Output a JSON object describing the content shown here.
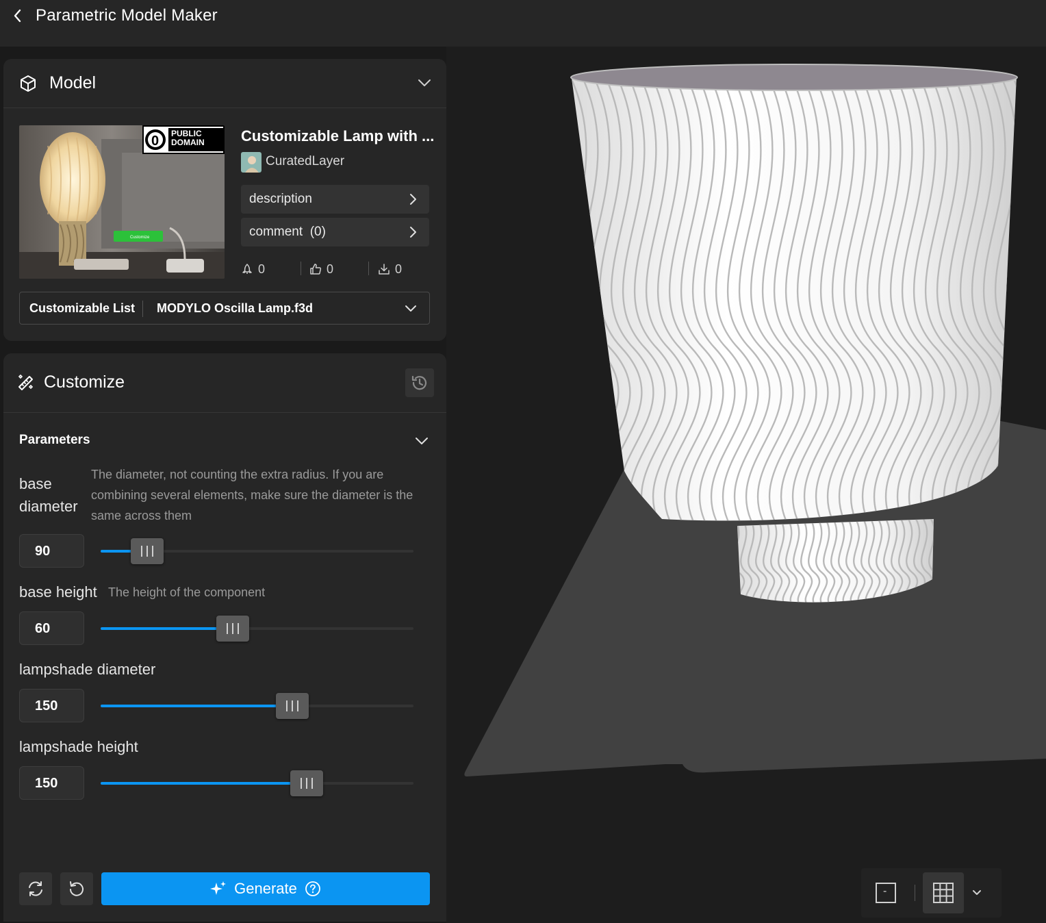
{
  "header": {
    "title": "Parametric Model Maker"
  },
  "model": {
    "section_title": "Model",
    "name": "Customizable Lamp with ...",
    "author": "CuratedLayer",
    "license_badge": "PUBLIC DOMAIN",
    "license_symbol": "0",
    "thumb_button_label": "Customize",
    "description_label": "description",
    "comment_label": "comment",
    "comment_count": "(0)",
    "stats": {
      "boosts": "0",
      "likes": "0",
      "downloads": "0"
    },
    "customizable_list": {
      "label": "Customizable List",
      "value": "MODYLO Oscilla Lamp.f3d"
    }
  },
  "customize": {
    "section_title": "Customize",
    "parameters_title": "Parameters",
    "params": [
      {
        "label_line1": "base",
        "label_line2": "diameter",
        "description": "The diameter, not counting the extra radius. If you are combining several elements, make sure the diameter is the same across them",
        "value": "90",
        "fraction": 0.1
      },
      {
        "label": "base height",
        "description": "The height of the component",
        "value": "60",
        "fraction": 0.375
      },
      {
        "label": "lampshade diameter",
        "value": "150",
        "fraction": 0.565
      },
      {
        "label": "lampshade height",
        "value": "150",
        "fraction": 0.61
      }
    ],
    "generate_label": "Generate"
  },
  "viewport": {
    "view_button": "-"
  },
  "colors": {
    "accent": "#0b95f2",
    "panel": "#262626",
    "background": "#1a1a1a"
  }
}
